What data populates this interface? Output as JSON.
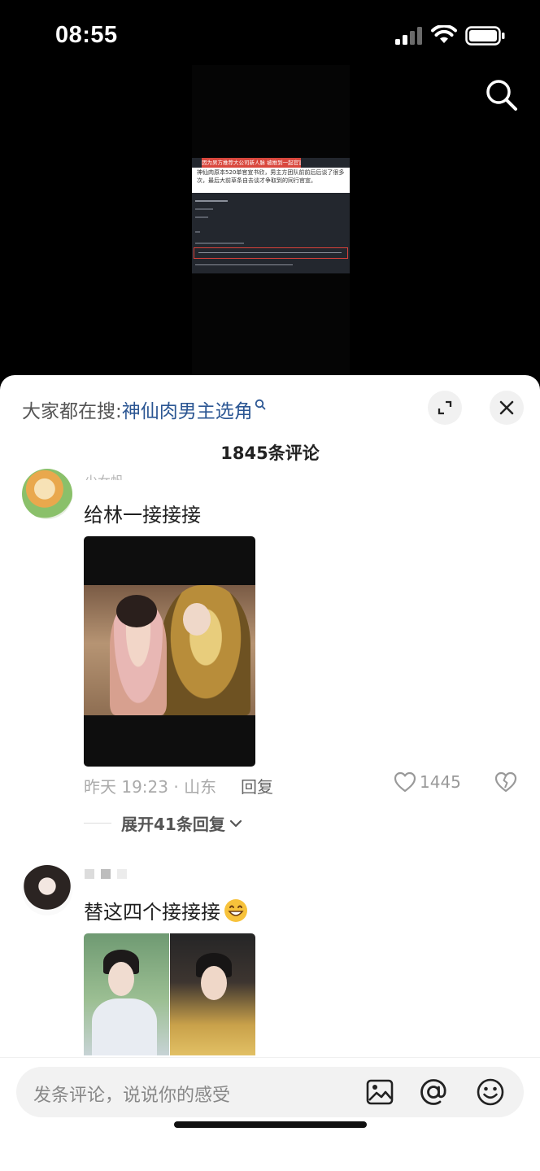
{
  "status_bar": {
    "time": "08:55"
  },
  "video": {
    "banner_text": "因为男方推荐大公司新人脉 被推到一起官宣",
    "caption_text": "神仙肉原本520单官宣书欣，男主方团队前前后后谈了很多次，最后大前草条自去谈才争取到的同行官宣。"
  },
  "sheet": {
    "hot_search_prefix": "大家都在搜:",
    "hot_search_term": "神仙肉男主选角",
    "comment_count": "1845条评论"
  },
  "comments": [
    {
      "username": "少女帆",
      "text": "给林一接接接",
      "time_location": "昨天 19:23 · 山东",
      "reply_label": "回复",
      "likes": "1445",
      "expand_label": "展开41条回复"
    },
    {
      "text": "替这四个接接接"
    }
  ],
  "input_bar": {
    "placeholder": "发条评论，说说你的感受"
  },
  "icons": {
    "search": "search-icon",
    "expand": "expand-icon",
    "close": "close-icon",
    "like": "heart-icon",
    "dislike": "broken-heart-icon",
    "image": "image-icon",
    "mention": "at-icon",
    "emoji": "emoji-icon"
  },
  "colors": {
    "link": "#2b5693",
    "background_dark": "#000000",
    "sheet_background": "#ffffff"
  }
}
